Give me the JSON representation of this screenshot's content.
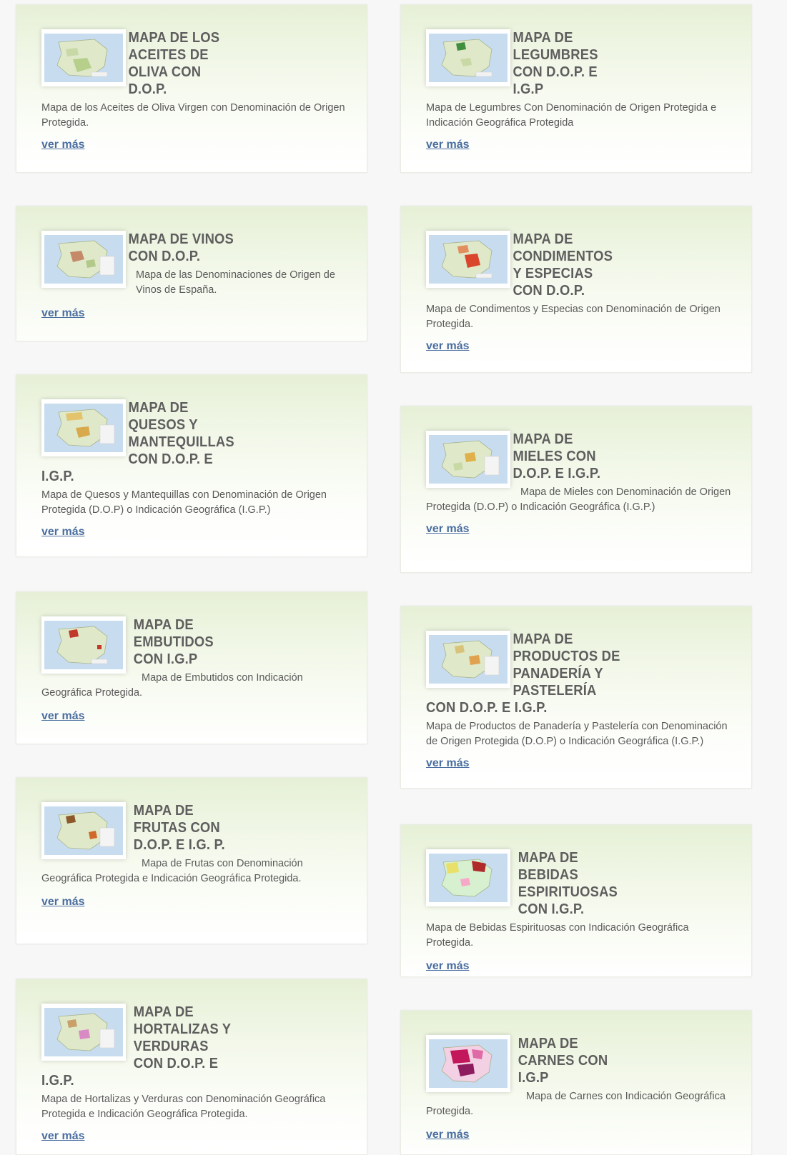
{
  "link_label": "ver más",
  "colors": {
    "accent_link": "#4a6ea0",
    "title": "#5e5e5e",
    "card_top": "#e6f0d6"
  },
  "cards": [
    {
      "title": "MAPA DE LOS ACEITES DE OLIVA CON D.O.P.",
      "description": "Mapa de los Aceites de Oliva Virgen con Denominación de Origen Protegida.",
      "link": "ver más",
      "icon": "map-thumbnail"
    },
    {
      "title": "MAPA DE LEGUMBRES CON D.O.P. E I.G.P",
      "description": "Mapa de Legumbres Con Denominación de Origen Protegida e Indicación Geográfica Protegida",
      "link": "ver más",
      "icon": "map-thumbnail"
    },
    {
      "title": "MAPA DE VINOS CON D.O.P.",
      "description": "Mapa de las Denominaciones de Origen de Vinos de España.",
      "link": "ver más",
      "icon": "map-thumbnail"
    },
    {
      "title": "MAPA DE CONDIMENTOS Y ESPECIAS CON D.O.P.",
      "description": "Mapa de Condimentos y Especias con Denominación de Origen Protegida.",
      "link": "ver más",
      "icon": "map-thumbnail"
    },
    {
      "title": "MAPA DE QUESOS Y MANTEQUILLAS CON D.O.P. E I.G.P.",
      "description": "Mapa de Quesos y Mantequillas con Denominación de Origen Protegida (D.O.P) o Indicación Geográfica (I.G.P.)",
      "link": "ver más",
      "icon": "map-thumbnail"
    },
    {
      "title": "MAPA DE MIELES CON D.O.P. E I.G.P.",
      "description": "Mapa de Mieles con Denominación de Origen Protegida (D.O.P) o Indicación Geográfica (I.G.P.)",
      "link": "ver más",
      "icon": "map-thumbnail"
    },
    {
      "title": "MAPA DE EMBUTIDOS CON I.G.P",
      "description": "Mapa de Embutidos con Indicación Geográfica Protegida.",
      "link": "ver más",
      "icon": "map-thumbnail"
    },
    {
      "title": "MAPA DE PRODUCTOS DE PANADERÍA Y PASTELERÍA CON D.O.P. E I.G.P.",
      "description": "Mapa de Productos de Panadería y Pastelería con Denominación de Origen Protegida (D.O.P) o Indicación Geográfica (I.G.P.)",
      "link": "ver más",
      "icon": "map-thumbnail"
    },
    {
      "title": "MAPA DE FRUTAS CON D.O.P. E I.G. P.",
      "description": "Mapa de Frutas con Denominación Geográfica Protegida e Indicación Geográfica Protegida.",
      "link": "ver más",
      "icon": "map-thumbnail"
    },
    {
      "title": "MAPA DE BEBIDAS ESPIRITUOSAS CON I.G.P.",
      "description": "Mapa de Bebidas Espirituosas con Indicación Geográfica Protegida.",
      "link": "ver más",
      "icon": "map-thumbnail"
    },
    {
      "title": "MAPA DE HORTALIZAS Y VERDURAS CON D.O.P. E I.G.P.",
      "description": "Mapa de Hortalizas y Verduras con Denominación Geográfica Protegida e Indicación Geográfica Protegida.",
      "link": "ver más",
      "icon": "map-thumbnail"
    },
    {
      "title": "MAPA DE CARNES CON I.G.P",
      "description": "Mapa de Carnes con Indicación Geográfica Protegida.",
      "link": "ver más",
      "icon": "map-thumbnail"
    }
  ]
}
